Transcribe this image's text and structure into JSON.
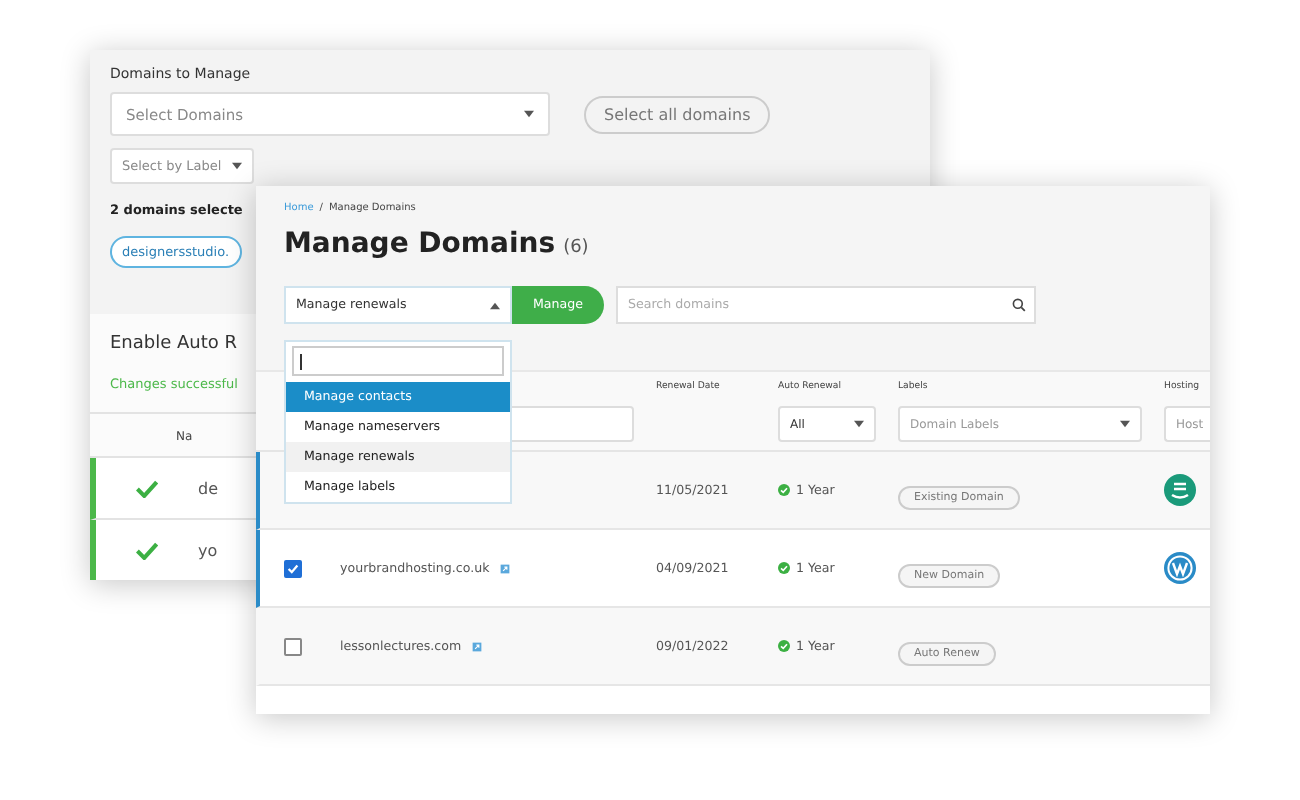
{
  "back_window": {
    "label": "Domains to Manage",
    "domain_select": {
      "placeholder": "Select Domains"
    },
    "select_all_button": "Select all domains",
    "label_select": {
      "placeholder": "Select by Label"
    },
    "selected_count": "2 domains selecte",
    "selected_chip": "designersstudio.",
    "section_title": "Enable Auto R",
    "status_message": "Changes successful",
    "table_header": "Na",
    "rows": [
      {
        "success": true,
        "name": "de"
      },
      {
        "success": true,
        "name": "yo"
      }
    ]
  },
  "front_window": {
    "breadcrumb": [
      {
        "label": "Home",
        "link": true
      },
      {
        "label": "Manage Domains",
        "link": false
      }
    ],
    "breadcrumb_separator": "/",
    "title": "Manage Domains",
    "count": "(6)",
    "action_select": {
      "value": "Manage renewals",
      "expanded": true
    },
    "manage_button": "Manage",
    "search": {
      "placeholder": "Search domains"
    },
    "action_menu": {
      "items": [
        {
          "label": "Manage contacts",
          "selected": true,
          "highlighted": false
        },
        {
          "label": "Manage nameservers",
          "selected": false,
          "highlighted": false
        },
        {
          "label": "Manage renewals",
          "selected": false,
          "highlighted": true
        },
        {
          "label": "Manage labels",
          "selected": false,
          "highlighted": false
        }
      ]
    },
    "table": {
      "columns": [
        "Renewal Date",
        "Auto Renewal",
        "Labels",
        "Hosting"
      ],
      "filters": [
        {
          "value": "All"
        },
        {
          "placeholder": "Domain Labels"
        },
        {
          "placeholder": "Host"
        }
      ],
      "rows": [
        {
          "selected": true,
          "renewal_date": "11/05/2021",
          "auto_renewal": "1 Year",
          "label": "Existing Domain",
          "kind": "stack"
        },
        {
          "selected": true,
          "checked": true,
          "domain": "yourbrandhosting.co.uk",
          "renewal_date": "04/09/2021",
          "auto_renewal": "1 Year",
          "label": "New Domain",
          "kind": "wp"
        },
        {
          "selected": false,
          "checked": false,
          "domain": "lessonlectures.com",
          "renewal_date": "09/01/2022",
          "auto_renewal": "1 Year",
          "label": "Auto Renew",
          "kind": "none"
        }
      ]
    }
  }
}
